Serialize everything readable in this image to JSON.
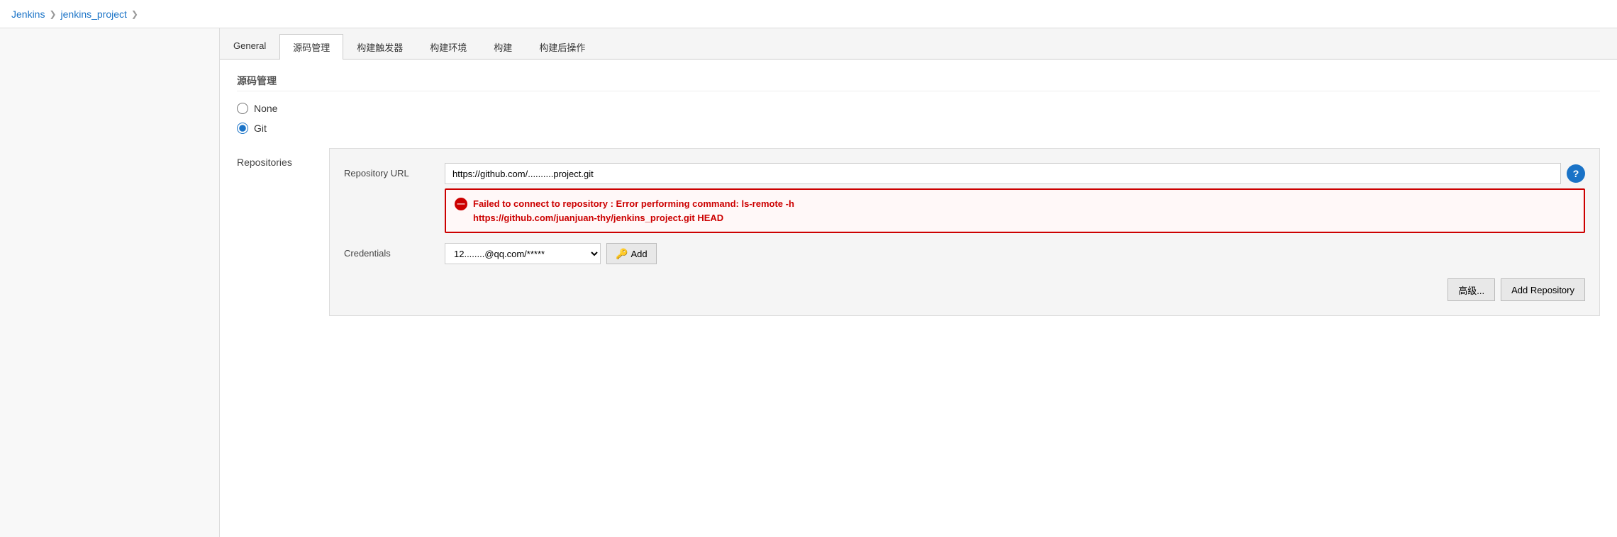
{
  "breadcrumb": {
    "items": [
      {
        "label": "Jenkins",
        "id": "jenkins"
      },
      {
        "label": "jenkins_project",
        "id": "jenkins-project"
      }
    ],
    "separator": "❯"
  },
  "tabs": [
    {
      "id": "general",
      "label": "General",
      "active": false
    },
    {
      "id": "source-mgmt",
      "label": "源码管理",
      "active": true
    },
    {
      "id": "build-trigger",
      "label": "构建触发器",
      "active": false
    },
    {
      "id": "build-env",
      "label": "构建环境",
      "active": false
    },
    {
      "id": "build",
      "label": "构建",
      "active": false
    },
    {
      "id": "post-build",
      "label": "构建后操作",
      "active": false
    }
  ],
  "section": {
    "title": "源码管理"
  },
  "scm_options": [
    {
      "id": "none",
      "label": "None",
      "checked": false
    },
    {
      "id": "git",
      "label": "Git",
      "checked": true
    }
  ],
  "repositories": {
    "label": "Repositories",
    "url_label": "Repository URL",
    "url_value": "https://github.com/..........project.git",
    "url_placeholder": "https://github.com/...project.git",
    "help_icon": "?",
    "error": {
      "text_line1": "Failed to connect to repository : Error performing command:  ls-remote -h",
      "text_line2": "https://github.com/juanjuan-thy/jenkins_project.git HEAD"
    },
    "credentials_label": "Credentials",
    "credentials_value": "12........@qq.com/*****",
    "credentials_placeholder": "12........@qq.com/*****",
    "add_button_label": "Add"
  },
  "buttons": {
    "advanced_label": "高级...",
    "add_repository_label": "Add Repository"
  }
}
